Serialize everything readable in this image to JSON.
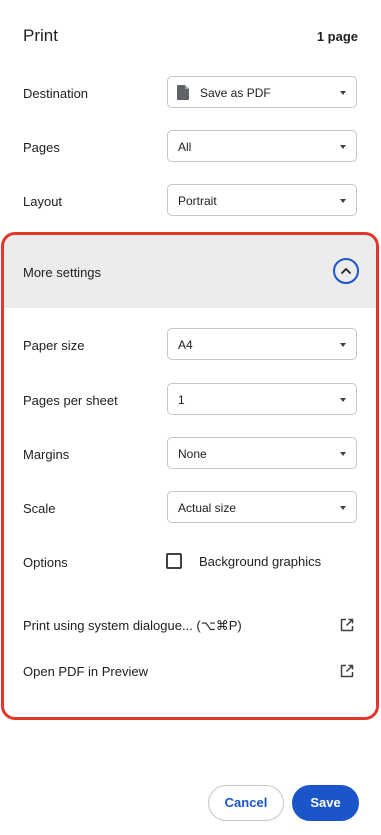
{
  "header": {
    "title": "Print",
    "page_count": "1 page"
  },
  "destination": {
    "label": "Destination",
    "value": "Save as PDF",
    "icon": "document-icon"
  },
  "pages": {
    "label": "Pages",
    "value": "All"
  },
  "layout": {
    "label": "Layout",
    "value": "Portrait"
  },
  "more_settings": {
    "label": "More settings",
    "expanded": true,
    "icon": "chevron-up-icon"
  },
  "paper_size": {
    "label": "Paper size",
    "value": "A4"
  },
  "pages_per_sheet": {
    "label": "Pages per sheet",
    "value": "1"
  },
  "margins": {
    "label": "Margins",
    "value": "None"
  },
  "scale": {
    "label": "Scale",
    "value": "Actual size"
  },
  "options": {
    "label": "Options",
    "background_graphics": {
      "label": "Background graphics",
      "checked": false
    }
  },
  "links": {
    "system_dialogue": {
      "label": "Print using system dialogue... (⌥⌘P)",
      "icon": "open-external-icon"
    },
    "open_preview": {
      "label": "Open PDF in Preview",
      "icon": "open-external-icon"
    }
  },
  "buttons": {
    "cancel": "Cancel",
    "save": "Save"
  },
  "colors": {
    "accent": "#1a56c9",
    "highlight": "#e3372b",
    "section_bg": "#ececec"
  }
}
